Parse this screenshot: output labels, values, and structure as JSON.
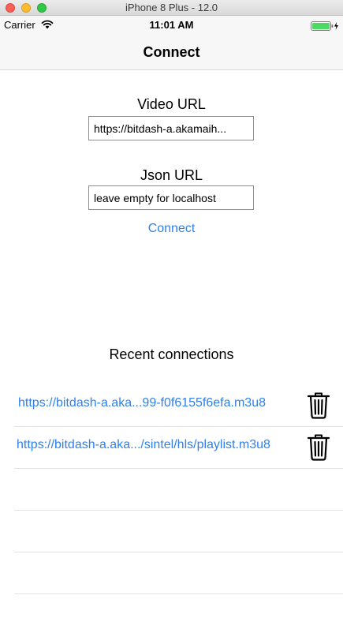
{
  "window": {
    "title": "iPhone 8 Plus - 12.0"
  },
  "status_bar": {
    "carrier": "Carrier",
    "time": "11:01 AM"
  },
  "nav": {
    "title": "Connect"
  },
  "form": {
    "video_label": "Video URL",
    "video_value": "https://bitdash-a.akamaih...",
    "json_label": "Json URL",
    "json_placeholder": "leave empty for localhost",
    "connect_label": "Connect"
  },
  "recent": {
    "title": "Recent connections",
    "items": [
      {
        "url": "https://bitdash-a.aka...99-f0f6155f6efa.m3u8",
        "delete_icon": "trash-icon"
      },
      {
        "url": "https://bitdash-a.aka.../sintel/hls/playlist.m3u8",
        "delete_icon": "trash-icon"
      }
    ]
  },
  "colors": {
    "link": "#2f80ed",
    "battery": "#4cd964"
  }
}
